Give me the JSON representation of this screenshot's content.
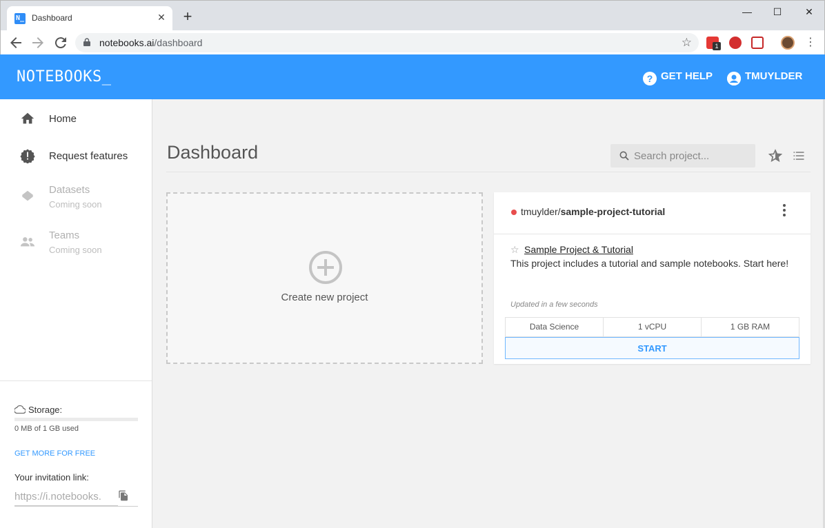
{
  "browser": {
    "tab_title": "Dashboard",
    "tab_favicon_text": "N_",
    "tab_close": "✕",
    "new_tab": "+",
    "url_host": "notebooks.ai",
    "url_path": "/dashboard",
    "ext_badge_count": "1",
    "window_controls": {
      "minimize": "—",
      "maximize": "☐",
      "close": "✕"
    }
  },
  "header": {
    "brand": "NOTEBOOKS_",
    "help_label": "GET HELP",
    "help_icon": "?",
    "user_label": "TMUYLDER",
    "colors": {
      "primary": "#3399ff",
      "text": "#ffffff"
    }
  },
  "sidebar": {
    "items": [
      {
        "label": "Home",
        "sub": "",
        "icon": "home-icon"
      },
      {
        "label": "Request features",
        "sub": "",
        "icon": "alert-badge-icon"
      },
      {
        "label": "Datasets",
        "sub": "Coming soon",
        "icon": "layers-icon"
      },
      {
        "label": "Teams",
        "sub": "Coming soon",
        "icon": "people-icon"
      }
    ],
    "storage": {
      "label": "Storage:",
      "used_text": "0 MB of 1 GB used",
      "used_fraction": 0.0
    },
    "get_more": "GET MORE FOR FREE",
    "invitation": {
      "label": "Your invitation link:",
      "value": "https://i.notebooks."
    }
  },
  "main": {
    "title": "Dashboard",
    "search_placeholder": "Search project...",
    "create_label": "Create new project",
    "projects": [
      {
        "owner": "tmuylder/",
        "name": "sample-project-tutorial",
        "status_color": "#e84d4d",
        "title": "Sample Project & Tutorial",
        "description": "This project includes a tutorial and sample notebooks. Start here!",
        "updated": "Updated in a few seconds",
        "specs": [
          "Data Science",
          "1 vCPU",
          "1 GB RAM"
        ],
        "start_label": "START"
      }
    ]
  }
}
